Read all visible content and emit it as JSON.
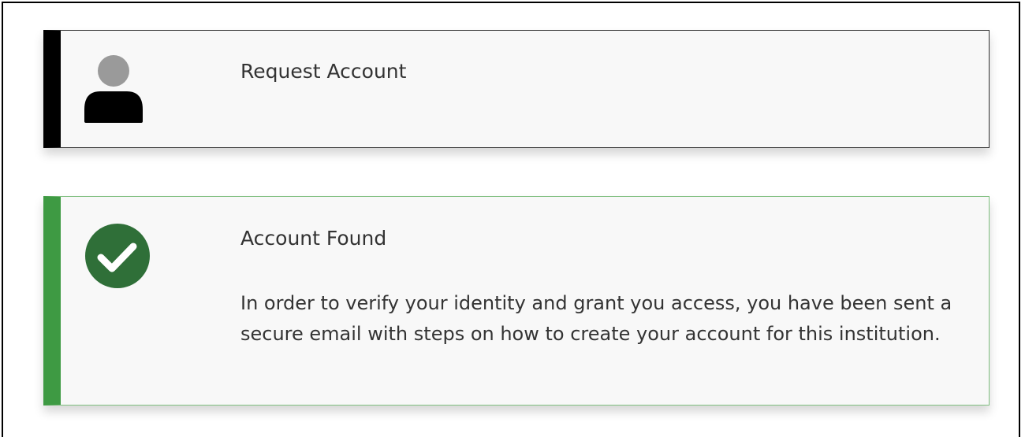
{
  "request_card": {
    "title": "Request Account",
    "icon": "user-icon",
    "accent_color": "#000000"
  },
  "found_card": {
    "title": "Account Found",
    "icon": "check-circle-icon",
    "accent_color": "#3e9a43",
    "message": "In order to verify your identity and grant you access, you have been sent a secure email with steps on how to create your account for this institution."
  }
}
